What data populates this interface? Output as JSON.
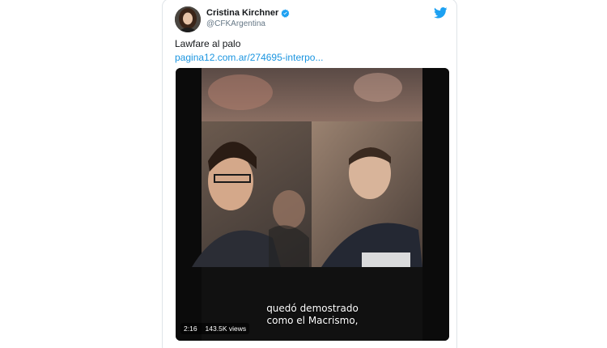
{
  "tweet": {
    "author": {
      "display_name": "Cristina Kirchner",
      "handle": "@CFKArgentina",
      "verified_icon": "verified-badge-icon",
      "avatar_icon": "profile-avatar"
    },
    "brand_icon": "twitter-bird-icon",
    "text": "Lawfare al palo",
    "link_text": "pagina12.com.ar/274695-interpo...",
    "colors": {
      "link": "#1b95e0",
      "name": "#14171a",
      "handle": "#657786",
      "brand": "#1da1f2"
    },
    "video": {
      "caption_line_1": "quedó demostrado",
      "caption_line_2": "como el Macrismo,",
      "duration": "2:16",
      "views": "143.5K views"
    }
  }
}
